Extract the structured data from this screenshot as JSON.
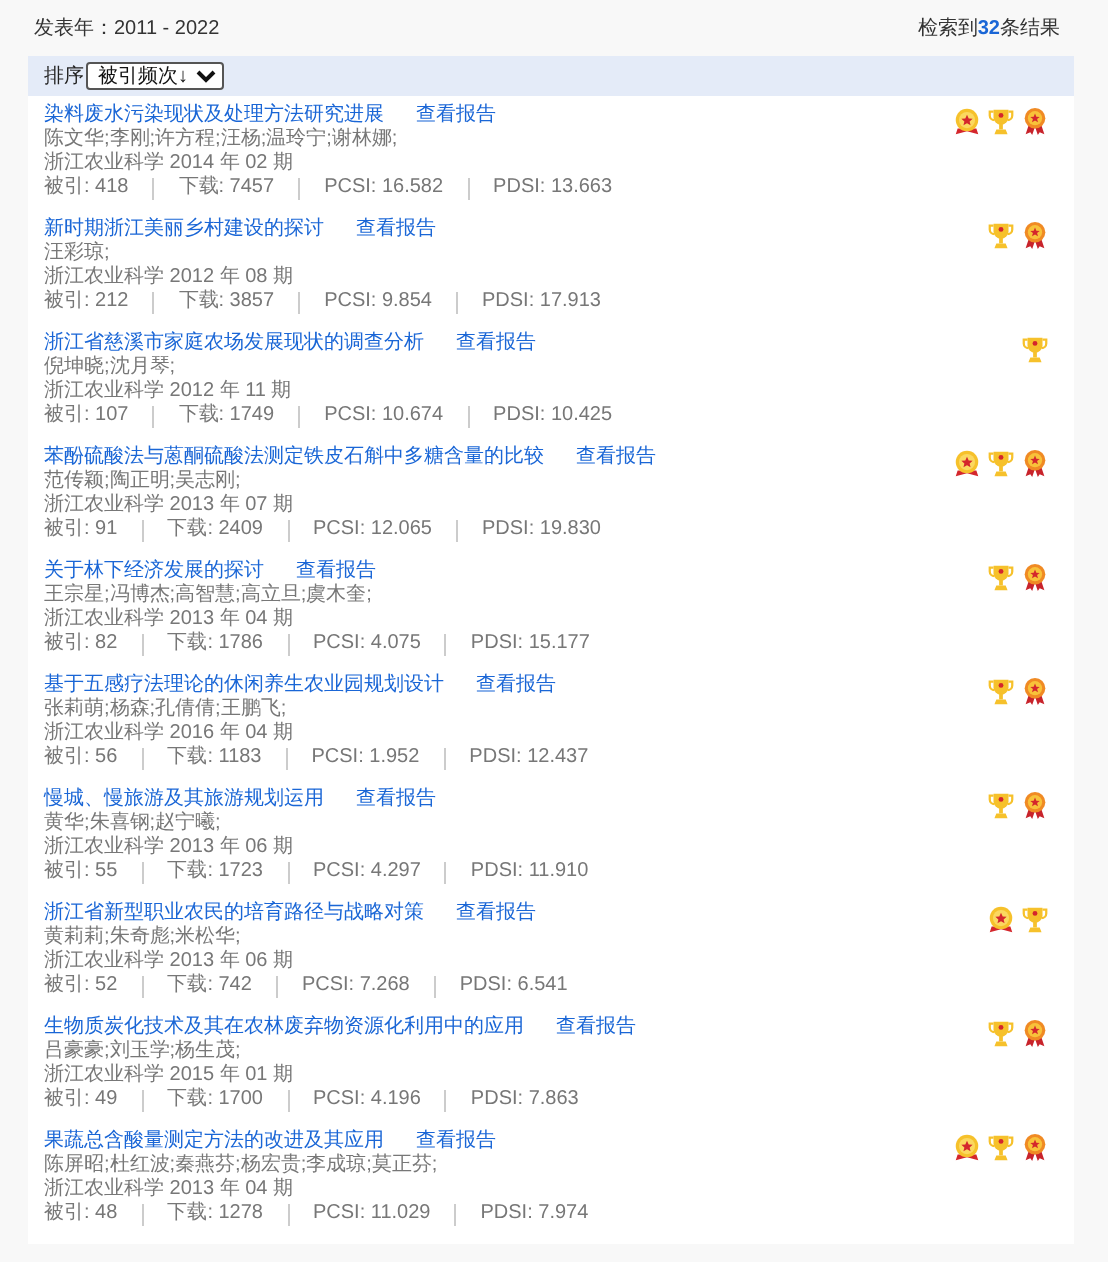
{
  "header": {
    "year_range": "发表年：2011 - 2022",
    "result_prefix": "检索到",
    "result_count": "32",
    "result_suffix": "条结果"
  },
  "sort": {
    "label": "排序",
    "value": "被引频次↓"
  },
  "articles": [
    {
      "title": "染料废水污染现状及处理方法研究进展",
      "report_link": "查看报告",
      "authors": "陈文华;李刚;许方程;汪杨;温玲宁;谢林娜;",
      "source": "浙江农业科学 2014 年 02 期",
      "stats": [
        "被引: 418",
        "下载: 7457",
        "PCSI: 16.582",
        "PDSI: 13.663"
      ],
      "badges": [
        {
          "kind": "medal"
        },
        {
          "kind": "trophy"
        },
        {
          "kind": "rosette"
        }
      ]
    },
    {
      "title": "新时期浙江美丽乡村建设的探讨",
      "report_link": "查看报告",
      "authors": "汪彩琼;",
      "source": "浙江农业科学 2012 年 08 期",
      "stats": [
        "被引: 212",
        "下载: 3857",
        "PCSI: 9.854",
        "PDSI: 17.913"
      ],
      "badges": [
        {
          "kind": "trophy"
        },
        {
          "kind": "rosette"
        }
      ]
    },
    {
      "title": "浙江省慈溪市家庭农场发展现状的调查分析",
      "report_link": "查看报告",
      "authors": "倪坤晓;沈月琴;",
      "source": "浙江农业科学 2012 年 11 期",
      "stats": [
        "被引: 107",
        "下载: 1749",
        "PCSI: 10.674",
        "PDSI: 10.425"
      ],
      "badges": [
        {
          "kind": "trophy"
        }
      ]
    },
    {
      "title": "苯酚硫酸法与蒽酮硫酸法测定铁皮石斛中多糖含量的比较",
      "report_link": "查看报告",
      "authors": "范传颖;陶正明;吴志刚;",
      "source": "浙江农业科学 2013 年 07 期",
      "stats": [
        "被引: 91",
        "下载: 2409",
        "PCSI: 12.065",
        "PDSI: 19.830"
      ],
      "badges": [
        {
          "kind": "medal"
        },
        {
          "kind": "trophy"
        },
        {
          "kind": "rosette"
        }
      ]
    },
    {
      "title": "关于林下经济发展的探讨",
      "report_link": "查看报告",
      "authors": "王宗星;冯博杰;高智慧;高立旦;虞木奎;",
      "source": "浙江农业科学 2013 年 04 期",
      "stats": [
        "被引: 82",
        "下载: 1786",
        "PCSI: 4.075",
        "PDSI: 15.177"
      ],
      "badges": [
        {
          "kind": "trophy"
        },
        {
          "kind": "rosette"
        }
      ]
    },
    {
      "title": "基于五感疗法理论的休闲养生农业园规划设计",
      "report_link": "查看报告",
      "authors": "张莉萌;杨森;孔倩倩;王鹏飞;",
      "source": "浙江农业科学 2016 年 04 期",
      "stats": [
        "被引: 56",
        "下载: 1183",
        "PCSI: 1.952",
        "PDSI: 12.437"
      ],
      "badges": [
        {
          "kind": "trophy"
        },
        {
          "kind": "rosette"
        }
      ]
    },
    {
      "title": "慢城、慢旅游及其旅游规划运用",
      "report_link": "查看报告",
      "authors": "黄华;朱喜钢;赵宁曦;",
      "source": "浙江农业科学 2013 年 06 期",
      "stats": [
        "被引: 55",
        "下载: 1723",
        "PCSI: 4.297",
        "PDSI: 11.910"
      ],
      "badges": [
        {
          "kind": "trophy"
        },
        {
          "kind": "rosette"
        }
      ]
    },
    {
      "title": "浙江省新型职业农民的培育路径与战略对策",
      "report_link": "查看报告",
      "authors": "黄莉莉;朱奇彪;米松华;",
      "source": "浙江农业科学 2013 年 06 期",
      "stats": [
        "被引: 52",
        "下载: 742",
        "PCSI: 7.268",
        "PDSI: 6.541"
      ],
      "badges": [
        {
          "kind": "medal"
        },
        {
          "kind": "trophy"
        }
      ]
    },
    {
      "title": "生物质炭化技术及其在农林废弃物资源化利用中的应用",
      "report_link": "查看报告",
      "authors": "吕豪豪;刘玉学;杨生茂;",
      "source": "浙江农业科学 2015 年 01 期",
      "stats": [
        "被引: 49",
        "下载: 1700",
        "PCSI: 4.196",
        "PDSI: 7.863"
      ],
      "badges": [
        {
          "kind": "trophy"
        },
        {
          "kind": "rosette"
        }
      ]
    },
    {
      "title": "果蔬总含酸量测定方法的改进及其应用",
      "report_link": "查看报告",
      "authors": "陈屏昭;杜红波;秦燕芬;杨宏贵;李成琼;莫正芬;",
      "source": "浙江农业科学 2013 年 04 期",
      "stats": [
        "被引: 48",
        "下载: 1278",
        "PCSI: 11.029",
        "PDSI: 7.974"
      ],
      "badges": [
        {
          "kind": "medal"
        },
        {
          "kind": "trophy"
        },
        {
          "kind": "rosette"
        }
      ]
    }
  ]
}
